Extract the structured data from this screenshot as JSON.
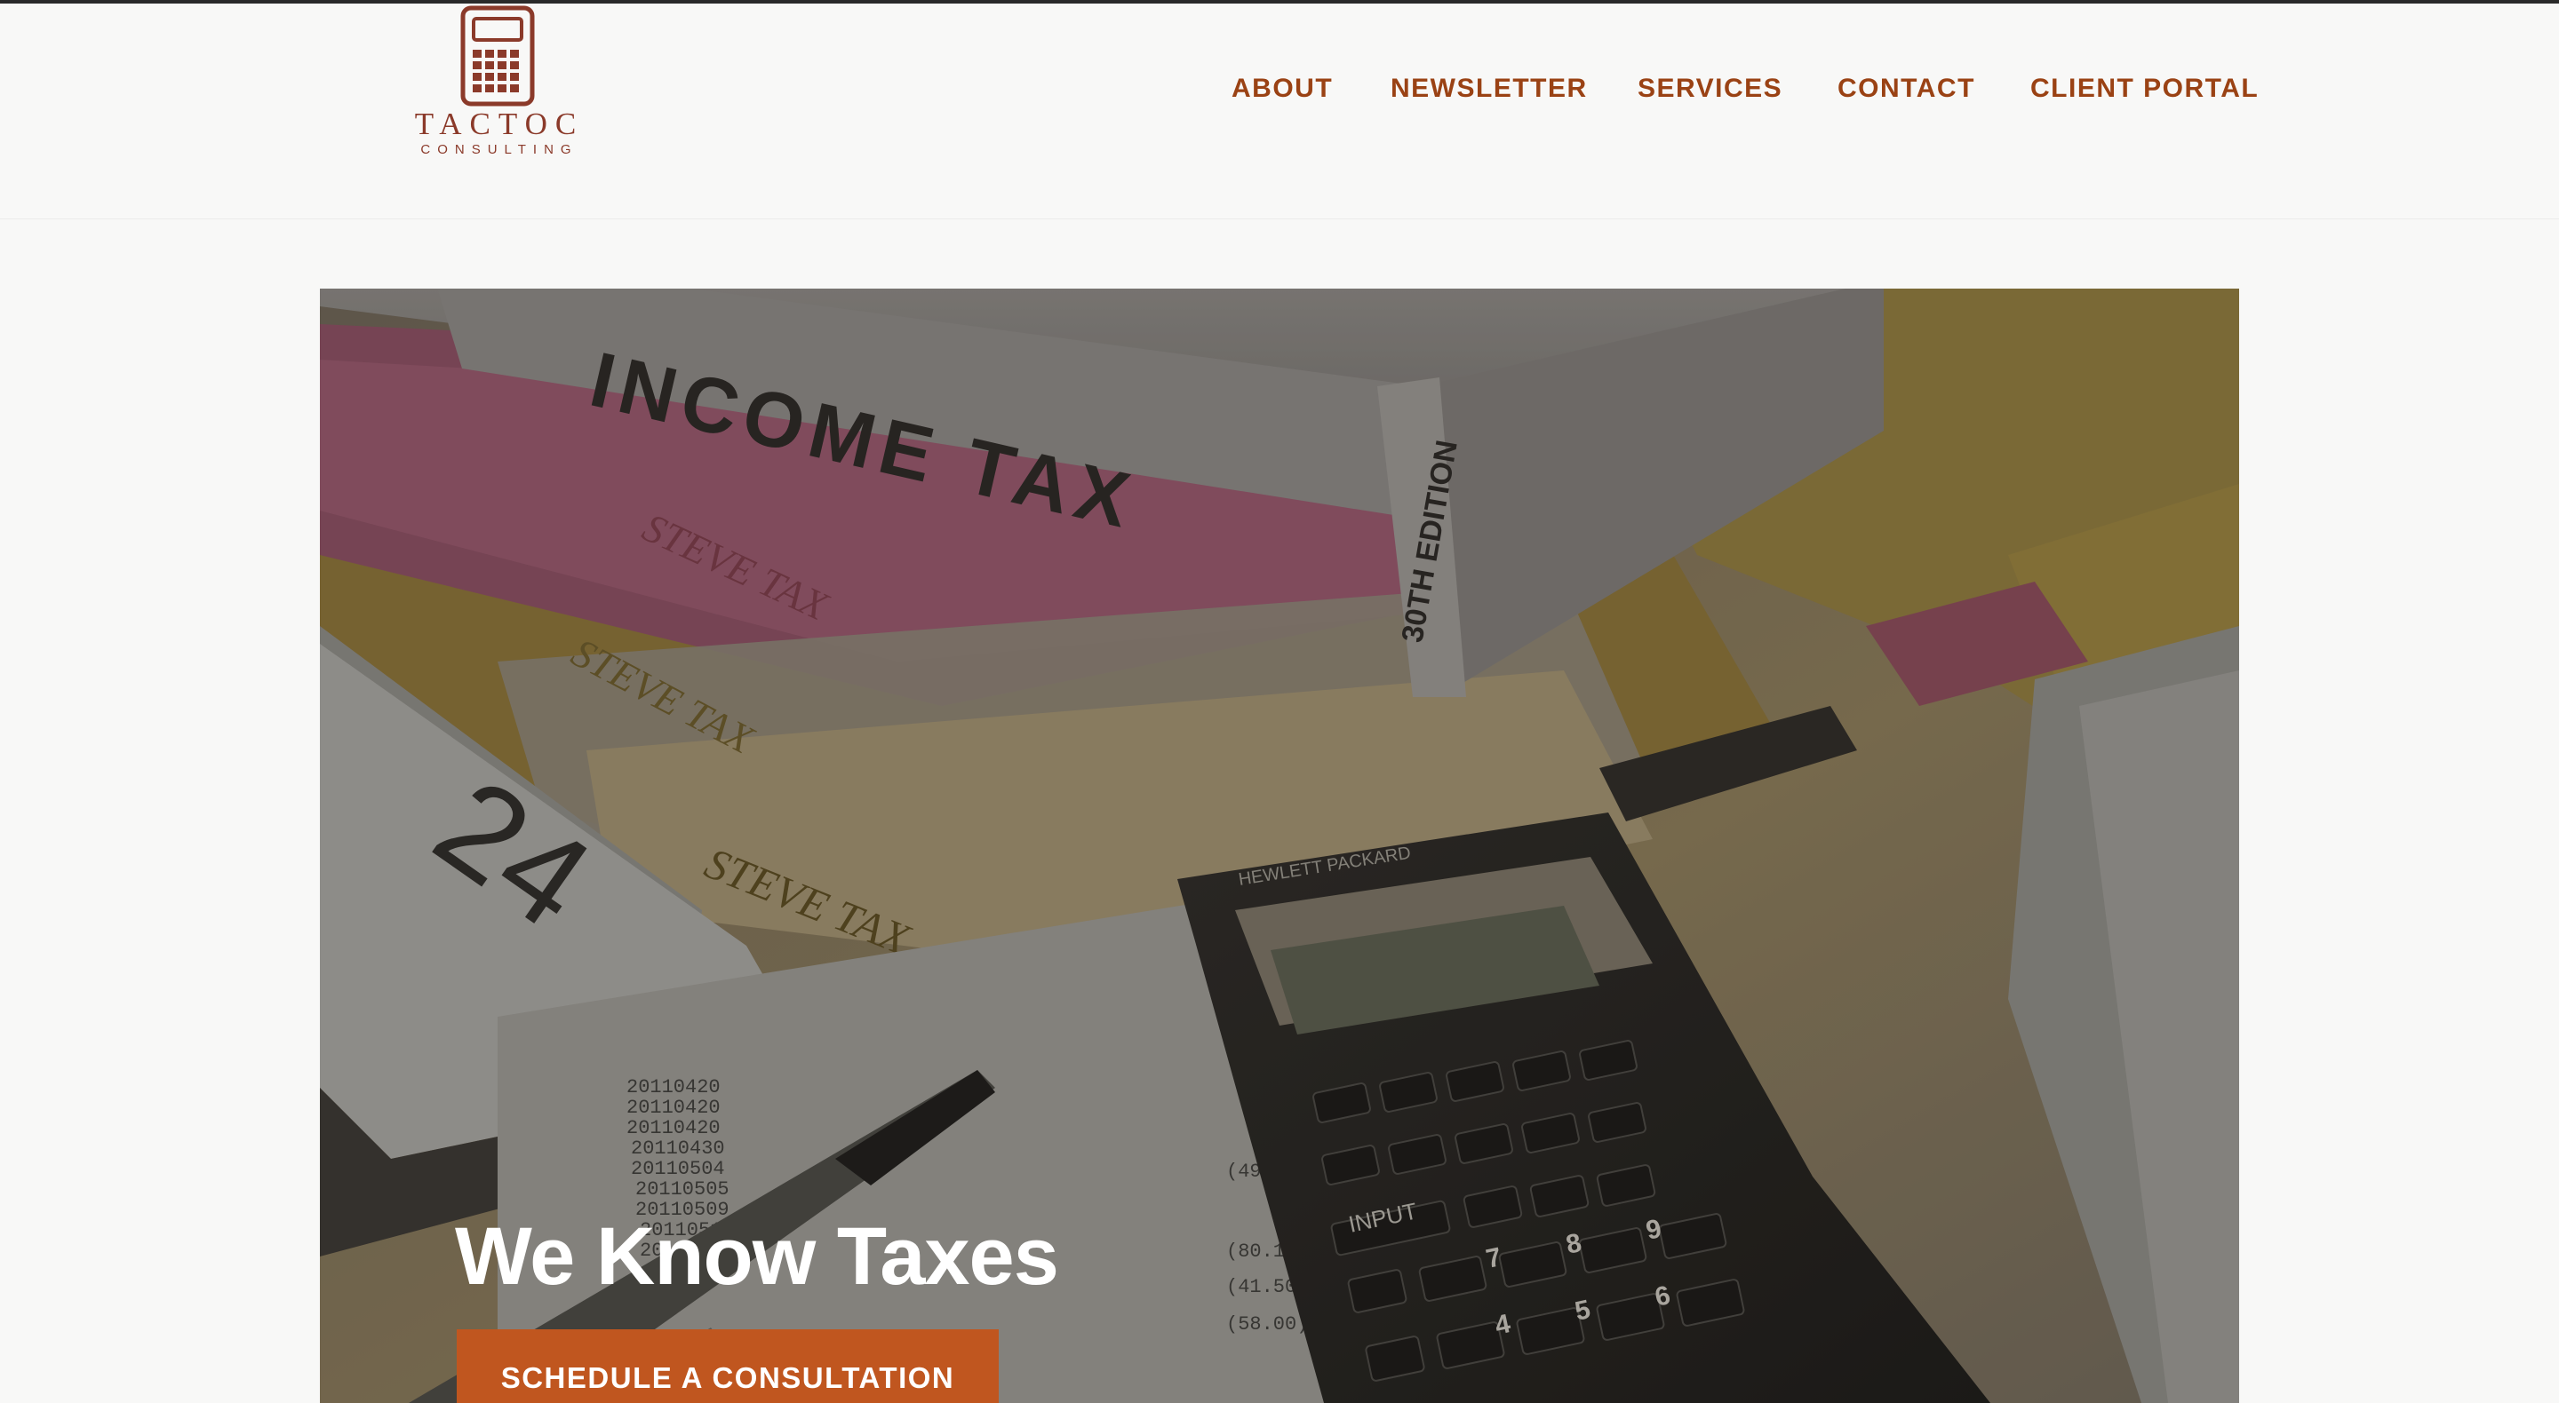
{
  "brand": {
    "name": "TACTOC",
    "tagline": "CONSULTING",
    "color": "#8b3a2a"
  },
  "nav": {
    "items": [
      {
        "label": "ABOUT"
      },
      {
        "label": "NEWSLETTER"
      },
      {
        "label": "SERVICES"
      },
      {
        "label": "CONTACT"
      },
      {
        "label": "CLIENT PORTAL"
      }
    ],
    "color": "#9a4214"
  },
  "hero": {
    "title": "We Know Taxes",
    "cta_label": "SCHEDULE A CONSULTATION",
    "cta_color": "#c0561f",
    "image_text": {
      "book_spine": "INCOME TAX",
      "book_edition": "30TH EDITION",
      "calendar_day": "24",
      "calculator_brand": "HEWLETT PACKARD",
      "calculator_key_input": "INPUT"
    }
  }
}
